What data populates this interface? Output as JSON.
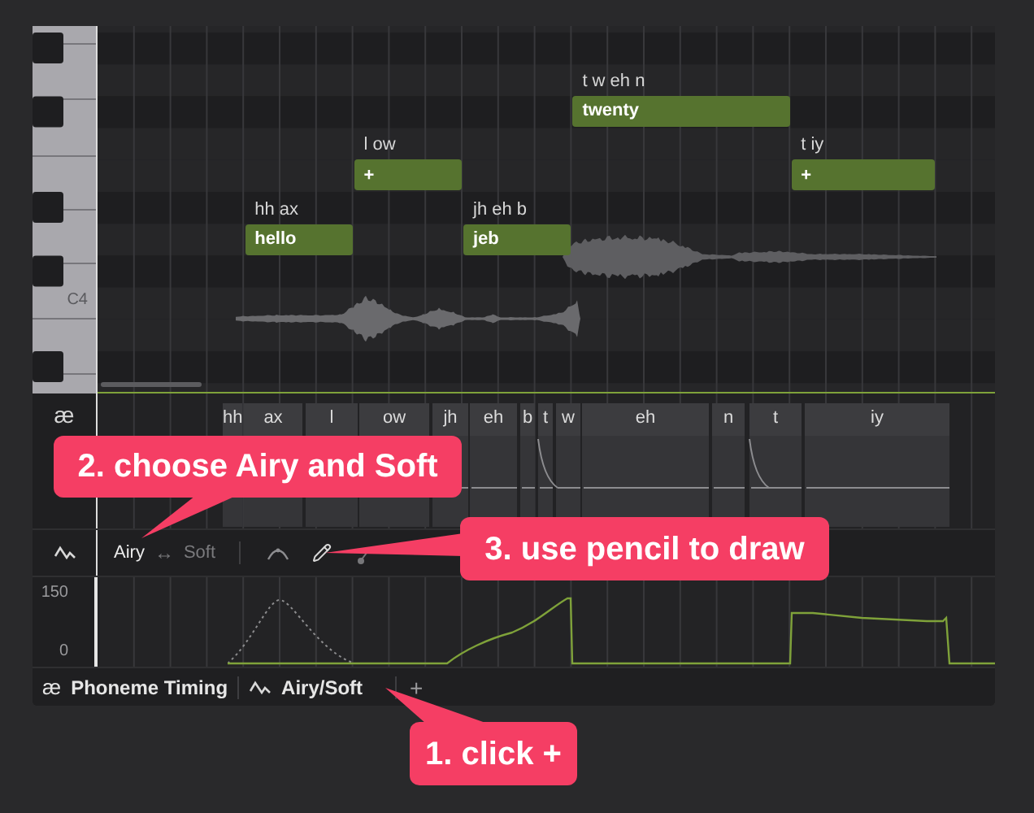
{
  "piano": {
    "octave_label": "C4"
  },
  "notes": [
    {
      "lyric": "hello",
      "phonemes": "hh ax"
    },
    {
      "lyric": "+",
      "phonemes": "l ow"
    },
    {
      "lyric": "jeb",
      "phonemes": "jh eh b"
    },
    {
      "lyric": "twenty",
      "phonemes": "t w eh n"
    },
    {
      "lyric": "+",
      "phonemes": "t iy"
    }
  ],
  "phoneme_track": {
    "icon": "æ",
    "phonemes": [
      "hh",
      "ax",
      "l",
      "ow",
      "jh",
      "eh",
      "b",
      "t",
      "w",
      "eh",
      "n",
      "t",
      "iy"
    ]
  },
  "expression_toolbar": {
    "options": [
      {
        "label": "Airy",
        "selected": true
      },
      {
        "label": "Soft",
        "selected": false
      }
    ],
    "swap_symbol": "↔"
  },
  "expression_chart": {
    "y_axis_labels": [
      "150",
      "0"
    ]
  },
  "track_tabs": [
    {
      "kind": "text-icon",
      "icon": "æ",
      "label": "Phoneme Timing"
    },
    {
      "kind": "curve-icon",
      "label": "Airy/Soft"
    }
  ],
  "add_tab_button": {
    "label": "+"
  },
  "callouts": [
    {
      "text": "2. choose Airy and Soft"
    },
    {
      "text": "3. use pencil to draw"
    },
    {
      "text": "1. click +"
    }
  ]
}
